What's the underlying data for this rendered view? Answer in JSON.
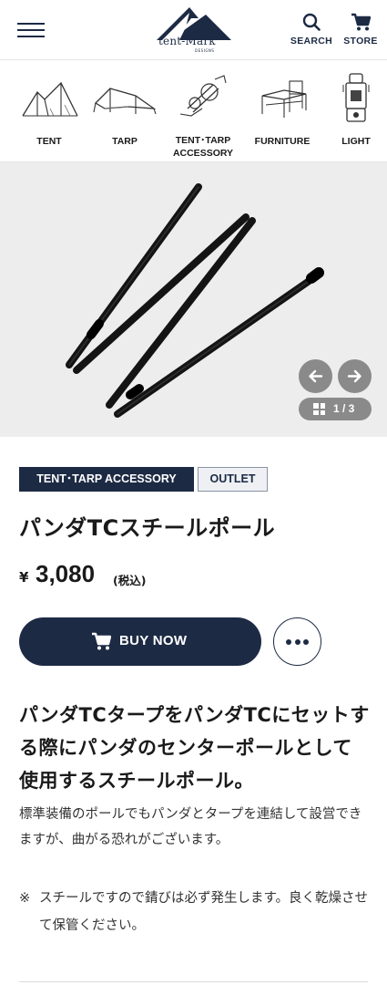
{
  "header": {
    "logo_text": "tent-Mark",
    "logo_sub": "DESIGNS",
    "search_label": "SEARCH",
    "store_label": "STORE",
    "menu_icon": "hamburger-icon",
    "search_icon": "search-icon",
    "store_icon": "cart-icon"
  },
  "categories": [
    {
      "label": "TENT",
      "icon": "tent-icon"
    },
    {
      "label": "TARP",
      "icon": "tarp-icon"
    },
    {
      "label_line1": "TENT･TARP",
      "label_line2": "ACCESSORY",
      "icon": "accessory-icon"
    },
    {
      "label": "FURNITURE",
      "icon": "furniture-icon"
    },
    {
      "label": "LIGHT",
      "icon": "light-icon"
    }
  ],
  "gallery": {
    "current": 1,
    "total": 3,
    "counter_text": "1 / 3",
    "prev_icon": "arrow-left-icon",
    "next_icon": "arrow-right-icon",
    "grid_icon": "grid-icon"
  },
  "product": {
    "badges": [
      "TENT･TARP ACCESSORY",
      "OUTLET"
    ],
    "title": "パンダTCスチールポール",
    "price_symbol": "¥",
    "price": "3,080",
    "tax_note": "(税込)",
    "buy_label": "BUY NOW",
    "more_icon": "more-dots-icon",
    "headline": "パンダTCタープをパンダTCにセットする際にパンダのセンターポールとして使用するスチールポール。",
    "description": "標準装備のポールでもパンダとタープを連結して設営できますが、曲がる恐れがございます。",
    "note_mark": "※",
    "note": "スチールですので錆びは必ず発生します。良く乾燥させて保管ください。"
  },
  "colors": {
    "navy": "#1c2a44",
    "gallery_bg": "#ededed",
    "nav_button": "#8a8a8a"
  }
}
